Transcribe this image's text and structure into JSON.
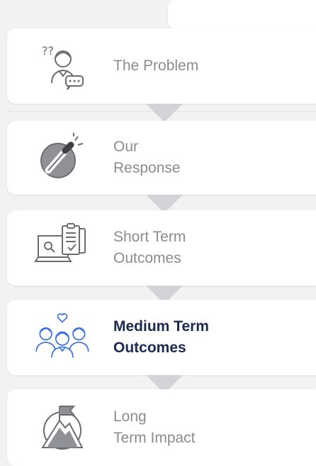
{
  "steps": [
    {
      "label": "The Problem",
      "icon": "person-question-icon",
      "active": false
    },
    {
      "label": "Our\nResponse",
      "icon": "magic-wand-icon",
      "active": false
    },
    {
      "label": "Short Term\nOutcomes",
      "icon": "clipboard-search-icon",
      "active": false
    },
    {
      "label": "Medium Term\nOutcomes",
      "icon": "people-group-heart-icon",
      "active": true
    },
    {
      "label": "Long\nTerm Impact",
      "icon": "mountain-flag-icon",
      "active": false
    }
  ],
  "colors": {
    "background": "#f2f2f3",
    "card": "#ffffff",
    "inactive_text": "#8a8c92",
    "active_text": "#1c2a4f",
    "active_icon": "#3a6fe0",
    "arrow": "#d4d4d8"
  }
}
